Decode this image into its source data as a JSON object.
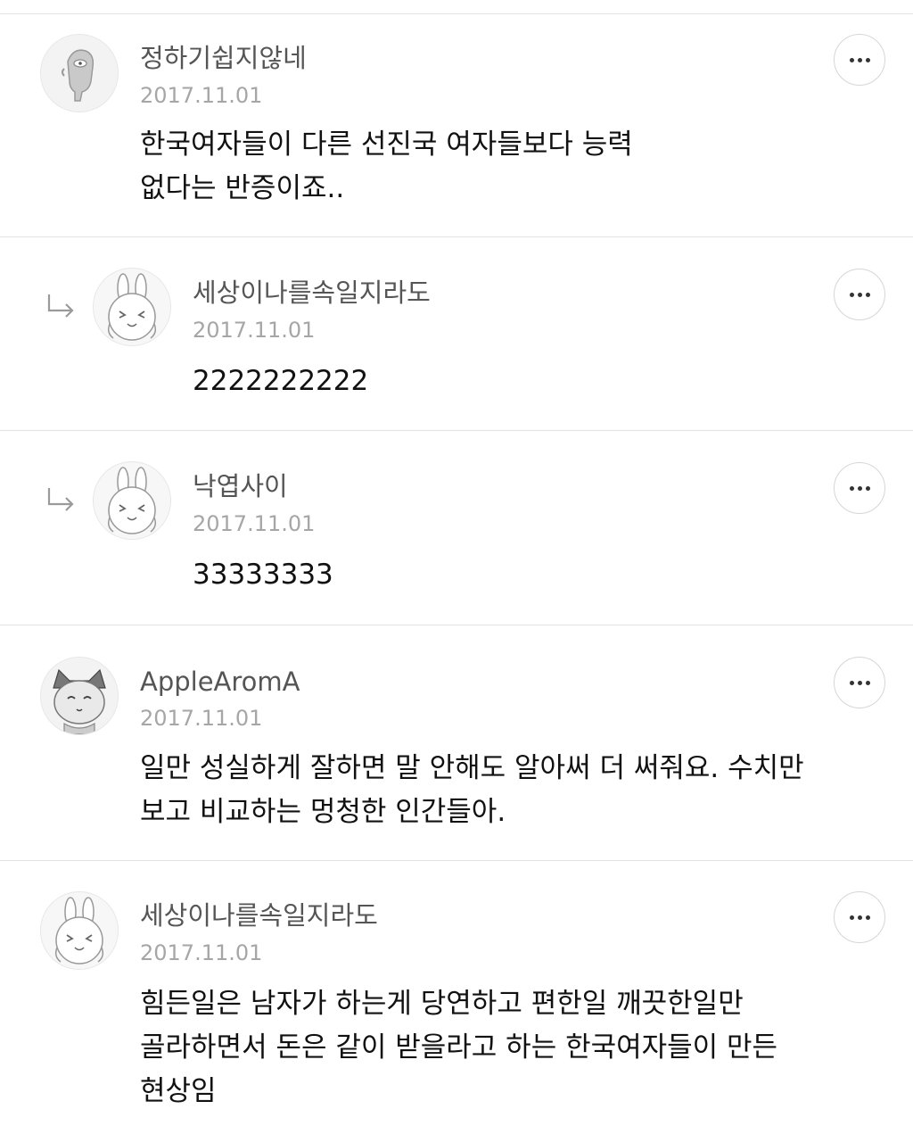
{
  "comments": [
    {
      "nickname": "정하기쉽지않네",
      "date": "2017.11.01",
      "text": "한국여자들이 다른 선진국 여자들보다 능력\n없다는 반증이죠..",
      "avatar_icon": "gray-character-icon",
      "is_reply": false
    },
    {
      "nickname": "세상이나를속일지라도",
      "date": "2017.11.01",
      "text": "2222222222",
      "avatar_icon": "rabbit-character-icon",
      "is_reply": true
    },
    {
      "nickname": "낙엽사이",
      "date": "2017.11.01",
      "text": "33333333",
      "avatar_icon": "rabbit-character-icon",
      "is_reply": true
    },
    {
      "nickname": "AppleAromA",
      "date": "2017.11.01",
      "text": "일만 성실하게 잘하면 말 안해도 알아써 더 써줘요. 수치만\n보고 비교하는 멍청한 인간들아.",
      "avatar_icon": "cat-character-icon",
      "is_reply": false
    },
    {
      "nickname": "세상이나를속일지라도",
      "date": "2017.11.01",
      "text": "힘든일은 남자가 하는게 당연하고 편한일 깨끗한일만\n골라하면서 돈은 같이 받을라고 하는 한국여자들이 만든\n현상임",
      "avatar_icon": "rabbit-character-icon",
      "is_reply": false
    }
  ],
  "colors": {
    "divider": "#e3e3e3",
    "nickname": "#555555",
    "date": "#a6a6a6",
    "text": "#111111"
  }
}
